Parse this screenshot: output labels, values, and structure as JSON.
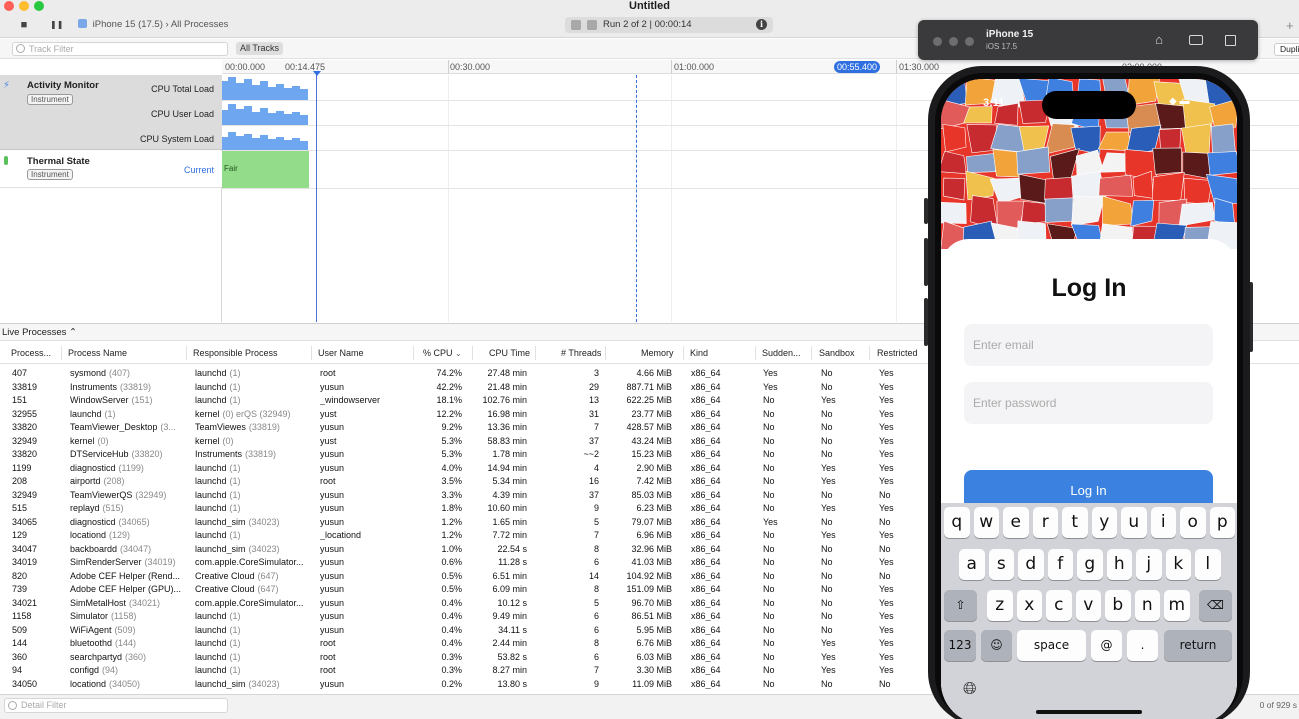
{
  "window": {
    "title": "Untitled",
    "device": "iPhone 15 (17.5)",
    "breadcrumb_sep": "›",
    "target": "All Processes",
    "run_text": "Run 2 of 2  |  00:00:14"
  },
  "toolbar": {
    "stop_icon": "■",
    "pause_icon": "❚❚",
    "info_icon": "i"
  },
  "filters": {
    "track_filter_placeholder": "Track Filter",
    "all_tracks": "All Tracks",
    "detail_filter_placeholder": "Detail Filter"
  },
  "timeline": {
    "ticks": [
      "00:00.000",
      "00:14.475",
      "00:30.000",
      "01:00.000",
      "01:30.000",
      "02:00.000"
    ],
    "playhead": "00:55.400"
  },
  "tracks": {
    "activity_monitor": {
      "name": "Activity Monitor",
      "badge": "Instrument",
      "lanes": [
        "CPU Total Load",
        "CPU User Load",
        "CPU System Load"
      ]
    },
    "thermal_state": {
      "name": "Thermal State",
      "badge": "Instrument",
      "current": "Current",
      "value": "Fair"
    }
  },
  "live_processes": {
    "label": "Live Processes ⌃"
  },
  "table": {
    "columns": [
      "Process...",
      "Process Name",
      "Responsible Process",
      "User Name",
      "% CPU",
      "CPU Time",
      "# Threads",
      "Memory",
      "Kind",
      "Sudden...",
      "Sandbox",
      "Restricted"
    ],
    "rows": [
      [
        "407",
        "sysmond",
        "(407)",
        "launchd",
        "(1)",
        "root",
        "74.2%",
        "27.48 min",
        "3",
        "4.66 MiB",
        "x86_64",
        "Yes",
        "No",
        "Yes"
      ],
      [
        "33819",
        "Instruments",
        "(33819)",
        "launchd",
        "(1)",
        "yusun",
        "42.2%",
        "21.48 min",
        "29",
        "887.71 MiB",
        "x86_64",
        "Yes",
        "No",
        "Yes"
      ],
      [
        "151",
        "WindowServer",
        "(151)",
        "launchd",
        "(1)",
        "_windowserver",
        "18.1%",
        "102.76 min",
        "13",
        "622.25 MiB",
        "x86_64",
        "No",
        "Yes",
        "Yes"
      ],
      [
        "32955",
        "launchd",
        "(1)",
        "kernel",
        "(0)  erQS (32949)",
        "yust",
        "12.2%",
        "16.98 min",
        "31",
        "23.77 MiB",
        "x86_64",
        "No",
        "No",
        "Yes"
      ],
      [
        "33820",
        "TeamViewer_Desktop",
        "(3...",
        "TeamViewes",
        "(33819)",
        "yusun",
        "9.2%",
        "13.36 min",
        "7",
        "428.57 MiB",
        "x86_64",
        "No",
        "No",
        "Yes"
      ],
      [
        "32949",
        "kernel",
        "(0)",
        "kernel",
        "(0)",
        "yust",
        "5.3%",
        "58.83 min",
        "37",
        "43.24 MiB",
        "x86_64",
        "No",
        "No",
        "Yes"
      ],
      [
        "33820",
        "DTServiceHub",
        "(33820)",
        "Instruments",
        "(33819)",
        "yusun",
        "5.3%",
        "1.78 min",
        "~~2",
        "15.23 MiB",
        "x86_64",
        "No",
        "No",
        "Yes"
      ],
      [
        "1199",
        "diagnosticd",
        "(1199)",
        "launchd",
        "(1)",
        "yusun",
        "4.0%",
        "14.94 min",
        "4",
        "2.90 MiB",
        "x86_64",
        "No",
        "Yes",
        "Yes"
      ],
      [
        "208",
        "airportd",
        "(208)",
        "launchd",
        "(1)",
        "root",
        "3.5%",
        "5.34 min",
        "16",
        "7.42 MiB",
        "x86_64",
        "No",
        "Yes",
        "Yes"
      ],
      [
        "32949",
        "TeamViewerQS",
        "(32949)",
        "launchd",
        "(1)",
        "yusun",
        "3.3%",
        "4.39 min",
        "37",
        "85.03 MiB",
        "x86_64",
        "No",
        "No",
        "No"
      ],
      [
        "515",
        "replayd",
        "(515)",
        "launchd",
        "(1)",
        "yusun",
        "1.8%",
        "10.60 min",
        "9",
        "6.23 MiB",
        "x86_64",
        "No",
        "Yes",
        "Yes"
      ],
      [
        "34065",
        "diagnosticd",
        "(34065)",
        "launchd_sim",
        "(34023)",
        "yusun",
        "1.2%",
        "1.65 min",
        "5",
        "79.07 MiB",
        "x86_64",
        "Yes",
        "No",
        "No"
      ],
      [
        "129",
        "locationd",
        "(129)",
        "launchd",
        "(1)",
        "_locationd",
        "1.2%",
        "7.72 min",
        "7",
        "6.96 MiB",
        "x86_64",
        "No",
        "Yes",
        "Yes"
      ],
      [
        "34047",
        "backboardd",
        "(34047)",
        "launchd_sim",
        "(34023)",
        "yusun",
        "1.0%",
        "22.54 s",
        "8",
        "32.96 MiB",
        "x86_64",
        "No",
        "No",
        "No"
      ],
      [
        "34019",
        "SimRenderServer",
        "(34019)",
        "com.apple.CoreSimulator...",
        "",
        "yusun",
        "0.6%",
        "11.28 s",
        "6",
        "41.03 MiB",
        "x86_64",
        "No",
        "No",
        "Yes"
      ],
      [
        "820",
        "Adobe CEF Helper (Rend...",
        "",
        "Creative Cloud",
        "(647)",
        "yusun",
        "0.5%",
        "6.51 min",
        "14",
        "104.92 MiB",
        "x86_64",
        "No",
        "No",
        "No"
      ],
      [
        "739",
        "Adobe CEF Helper (GPU)...",
        "",
        "Creative Cloud",
        "(647)",
        "yusun",
        "0.5%",
        "6.09 min",
        "8",
        "151.09 MiB",
        "x86_64",
        "No",
        "No",
        "Yes"
      ],
      [
        "34021",
        "SimMetalHost",
        "(34021)",
        "com.apple.CoreSimulator...",
        "",
        "yusun",
        "0.4%",
        "10.12 s",
        "5",
        "96.70 MiB",
        "x86_64",
        "No",
        "No",
        "Yes"
      ],
      [
        "1158",
        "Simulator",
        "(1158)",
        "launchd",
        "(1)",
        "yusun",
        "0.4%",
        "9.49 min",
        "6",
        "86.51 MiB",
        "x86_64",
        "No",
        "No",
        "Yes"
      ],
      [
        "509",
        "WiFiAgent",
        "(509)",
        "launchd",
        "(1)",
        "yusun",
        "0.4%",
        "34.11 s",
        "6",
        "5.95 MiB",
        "x86_64",
        "No",
        "No",
        "Yes"
      ],
      [
        "144",
        "bluetoothd",
        "(144)",
        "launchd",
        "(1)",
        "root",
        "0.4%",
        "2.44 min",
        "8",
        "6.76 MiB",
        "x86_64",
        "No",
        "Yes",
        "Yes"
      ],
      [
        "360",
        "searchpartyd",
        "(360)",
        "launchd",
        "(1)",
        "root",
        "0.3%",
        "53.82 s",
        "6",
        "6.03 MiB",
        "x86_64",
        "No",
        "Yes",
        "Yes"
      ],
      [
        "94",
        "configd",
        "(94)",
        "launchd",
        "(1)",
        "root",
        "0.3%",
        "8.27 min",
        "7",
        "3.30 MiB",
        "x86_64",
        "No",
        "Yes",
        "Yes"
      ],
      [
        "34050",
        "locationd",
        "(34050)",
        "launchd_sim",
        "(34023)",
        "yusun",
        "0.2%",
        "13.80 s",
        "9",
        "11.09 MiB",
        "x86_64",
        "No",
        "No",
        "No"
      ]
    ],
    "count": "0 of 929 s"
  },
  "simulator": {
    "name": "iPhone 15",
    "os": "iOS 17.5",
    "duplicate": "Dupli",
    "status_time": "3:11",
    "status_icons": "◆ ▬",
    "screen": {
      "title": "Log In",
      "email_placeholder": "Enter email",
      "password_placeholder": "Enter password",
      "login_button": "Log In"
    },
    "keyboard": {
      "row1": [
        "q",
        "w",
        "e",
        "r",
        "t",
        "y",
        "u",
        "i",
        "o",
        "p"
      ],
      "row2": [
        "a",
        "s",
        "d",
        "f",
        "g",
        "h",
        "j",
        "k",
        "l"
      ],
      "row3": [
        "z",
        "x",
        "c",
        "v",
        "b",
        "n",
        "m"
      ],
      "shift": "⇧",
      "delete": "⌫",
      "numbers": "123",
      "emoji": "☺",
      "space": "space",
      "at": "@",
      "dot": ".",
      "return": "return",
      "globe": "🌐︎"
    }
  },
  "colors": {
    "accent": "#2f6fe0",
    "cpu_graph": "#6ea6f0",
    "thermal_fair": "#93dc8a",
    "login_button": "#3b82e0"
  }
}
